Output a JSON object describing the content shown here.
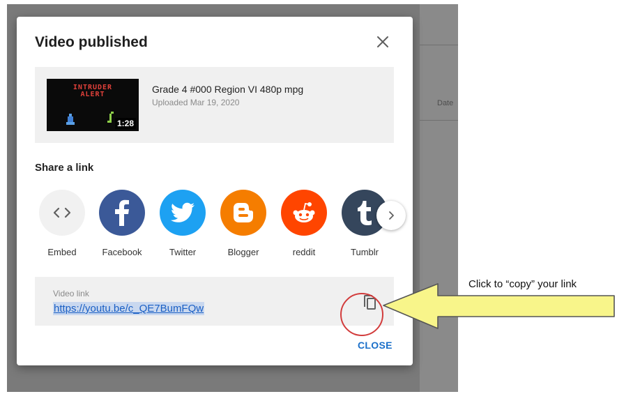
{
  "background": {
    "column_label": "Date"
  },
  "dialog": {
    "title": "Video published",
    "video": {
      "thumbnail_text": "INTRUDER\nALERT",
      "duration": "1:28",
      "name": "Grade 4 #000 Region VI 480p mpg",
      "uploaded": "Uploaded Mar 19, 2020"
    },
    "share": {
      "label": "Share a link",
      "items": [
        {
          "label": "Embed",
          "icon": "embed-icon",
          "color": "#f1f1f1"
        },
        {
          "label": "Facebook",
          "icon": "facebook-icon",
          "color": "#3b5998"
        },
        {
          "label": "Twitter",
          "icon": "twitter-icon",
          "color": "#1da1f2"
        },
        {
          "label": "Blogger",
          "icon": "blogger-icon",
          "color": "#f57d00"
        },
        {
          "label": "reddit",
          "icon": "reddit-icon",
          "color": "#ff4500"
        },
        {
          "label": "Tumblr",
          "icon": "tumblr-icon",
          "color": "#35465c"
        }
      ]
    },
    "link": {
      "label": "Video link",
      "url": "https://youtu.be/c_QE7BumFQw"
    },
    "close_label": "CLOSE"
  },
  "annotation": {
    "callout": "Click to “copy” your link",
    "arrow_color": "#f8f58a",
    "ring_color": "#d23c3c"
  }
}
